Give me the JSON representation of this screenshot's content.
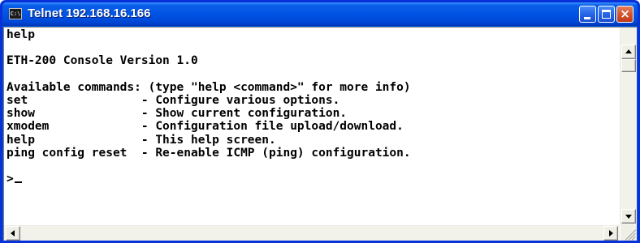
{
  "window": {
    "title": "Telnet 192.168.16.166",
    "icon": "console-icon",
    "icon_text": "C:\\"
  },
  "console": {
    "lines": [
      "help",
      "",
      "ETH-200 Console Version 1.0",
      "",
      "Available commands: (type \"help <command>\" for more info)",
      "set                - Configure various options.",
      "show               - Show current configuration.",
      "xmodem             - Configuration file upload/download.",
      "help               - This help screen.",
      "ping config reset  - Re-enable ICMP (ping) configuration.",
      "",
      ">"
    ]
  },
  "controls": {
    "close_label": "×"
  }
}
